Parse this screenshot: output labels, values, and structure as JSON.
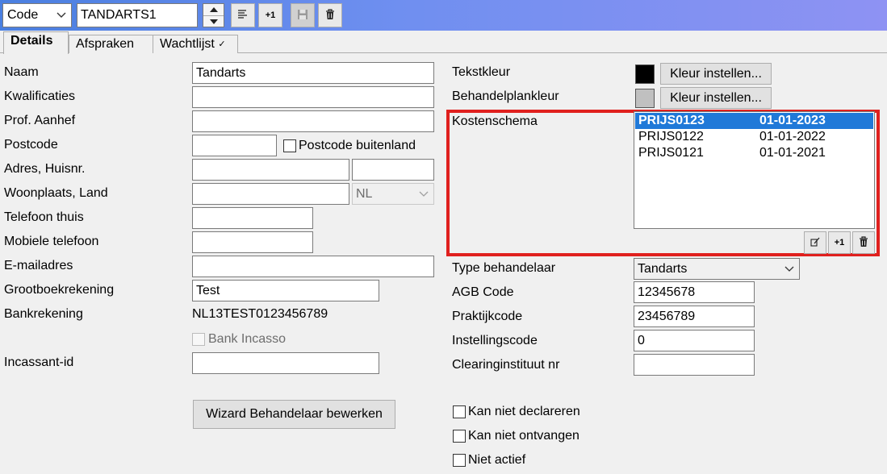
{
  "toolbar": {
    "search_field": "Code",
    "search_value": "TANDARTS1",
    "spin_up_icon": "up-arrow-icon",
    "spin_down_icon": "down-arrow-icon",
    "list_button_icon": "list-lines-icon",
    "new_button_label": "+1",
    "save_button_icon": "floppy-disk-icon",
    "delete_button_icon": "trash-icon"
  },
  "tabs": [
    {
      "label": "Details",
      "active": true
    },
    {
      "label": "Afspraken",
      "active": false
    },
    {
      "label": "Wachtlijst",
      "active": false,
      "badge": "✓"
    }
  ],
  "left": {
    "naam": {
      "label": "Naam",
      "value": "Tandarts"
    },
    "kwalificaties": {
      "label": "Kwalificaties",
      "value": ""
    },
    "aanhef": {
      "label": "Prof. Aanhef",
      "value": ""
    },
    "postcode": {
      "label": "Postcode",
      "value": "",
      "foreign_label": "Postcode buitenland"
    },
    "adres": {
      "label": "Adres, Huisnr.",
      "street": "",
      "number": ""
    },
    "woonplaats": {
      "label": "Woonplaats, Land",
      "city": "",
      "country": "NL"
    },
    "tel_thuis": {
      "label": "Telefoon thuis",
      "value": ""
    },
    "mobiel": {
      "label": "Mobiele telefoon",
      "value": ""
    },
    "email": {
      "label": "E-mailadres",
      "value": ""
    },
    "grootboek": {
      "label": "Grootboekrekening",
      "value": "Test"
    },
    "bank": {
      "label": "Bankrekening",
      "value": "NL13TEST0123456789"
    },
    "incasso": {
      "label": "Bank Incasso"
    },
    "incassant": {
      "label": "Incassant-id",
      "value": ""
    },
    "wizard_button": "Wizard Behandelaar bewerken"
  },
  "right": {
    "tekstkleur": {
      "label": "Tekstkleur",
      "color": "#000000",
      "button": "Kleur instellen..."
    },
    "planklkleur": {
      "label": "Behandelplankleur",
      "color": "#c0c0c0",
      "button": "Kleur instellen..."
    },
    "kosten": {
      "label": "Kostenschema",
      "rows": [
        {
          "code": "PRIJS0123",
          "date": "01-01-2023",
          "selected": true
        },
        {
          "code": "PRIJS0122",
          "date": "01-01-2022",
          "selected": false
        },
        {
          "code": "PRIJS0121",
          "date": "01-01-2021",
          "selected": false
        }
      ],
      "edit_icon": "edit-icon",
      "add_label": "+1",
      "delete_icon": "trash-icon"
    },
    "type": {
      "label": "Type behandelaar",
      "value": "Tandarts"
    },
    "agb": {
      "label": "AGB Code",
      "value": "12345678"
    },
    "praktijk": {
      "label": "Praktijkcode",
      "value": "23456789"
    },
    "instelling": {
      "label": "Instellingscode",
      "value": "0"
    },
    "clearing": {
      "label": "Clearinginstituut nr",
      "value": ""
    },
    "checks": [
      {
        "label": "Kan niet declareren",
        "checked": false
      },
      {
        "label": "Kan niet ontvangen",
        "checked": false
      },
      {
        "label": "Niet actief",
        "checked": false
      }
    ]
  },
  "colors": {
    "accent": "#2079d8",
    "highlight_border": "#e0201e"
  }
}
